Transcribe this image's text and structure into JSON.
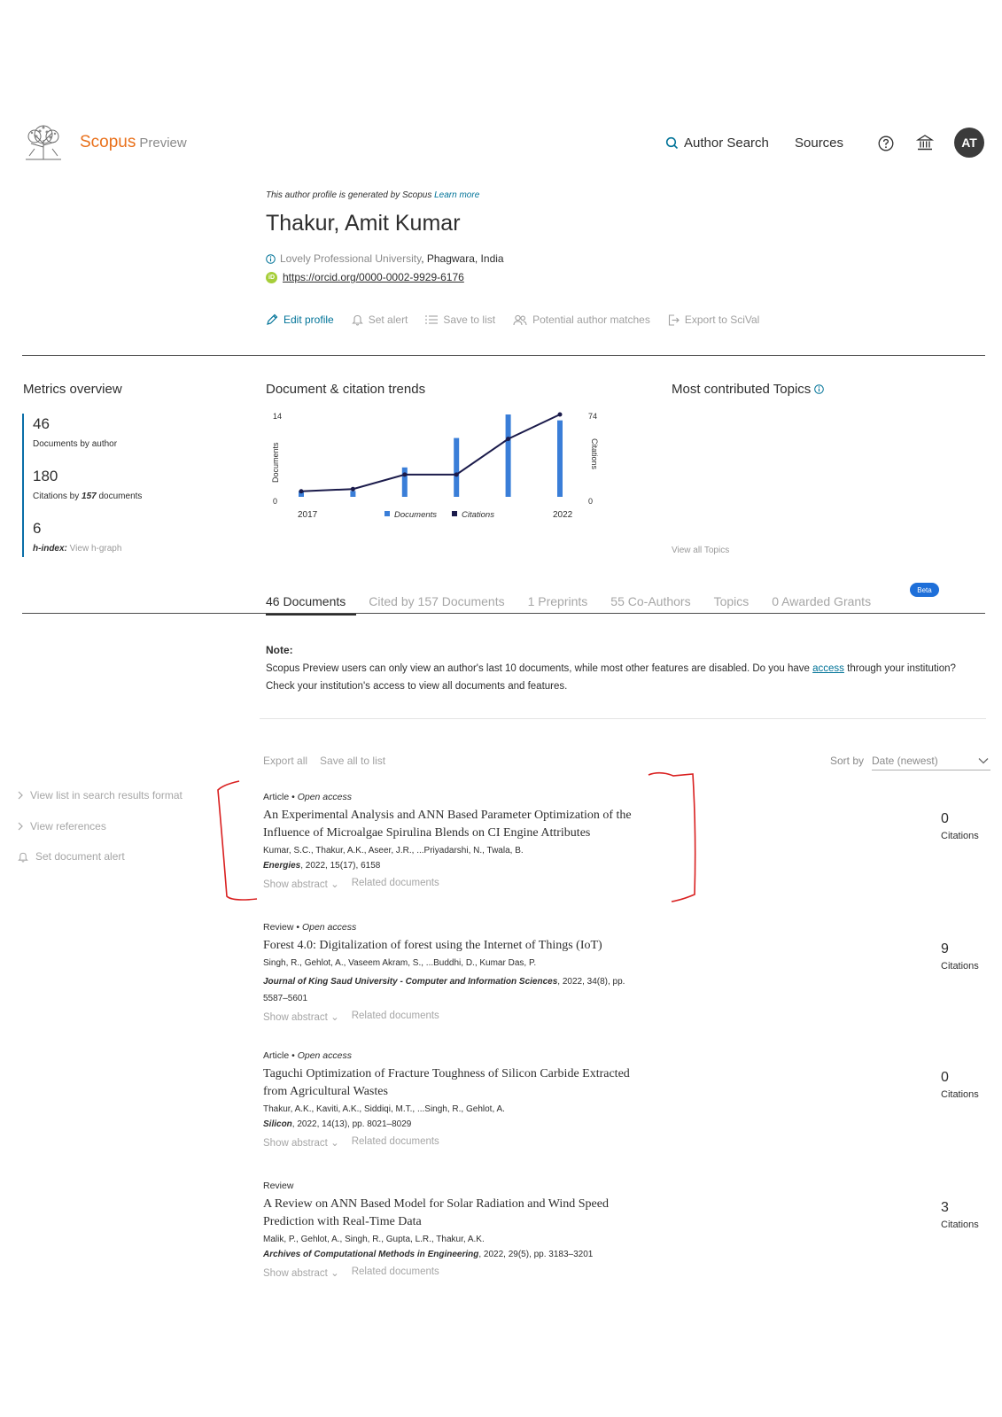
{
  "header": {
    "brand": "Scopus",
    "brand_suffix": "Preview",
    "nav_author_search": "Author Search",
    "nav_sources": "Sources",
    "avatar_initials": "AT",
    "icons": [
      "search-icon",
      "help-icon",
      "institution-icon"
    ]
  },
  "profile": {
    "generated_note": "This author profile is generated by Scopus",
    "learn_more": "Learn more",
    "name": "Thakur, Amit Kumar",
    "affiliation": "Lovely Professional University",
    "location": ", Phagwara, India",
    "orcid": "https://orcid.org/0000-0002-9929-6176",
    "orcid_badge": "iD",
    "actions": {
      "edit": "Edit profile",
      "alert": "Set alert",
      "save": "Save to list",
      "matches": "Potential author matches",
      "export": "Export to SciVal"
    }
  },
  "metrics": {
    "title": "Metrics overview",
    "documents_value": "46",
    "documents_label": "Documents by author",
    "citations_value": "180",
    "citations_label_pre": "Citations by ",
    "citations_label_num": "157",
    "citations_label_post": " documents",
    "hindex_value": "6",
    "hindex_label": "h-index:",
    "hindex_link": "View h-graph"
  },
  "trends": {
    "title": "Document & citation trends"
  },
  "topics": {
    "title": "Most contributed Topics",
    "view_all": "View all Topics"
  },
  "chart_data": {
    "type": "bar",
    "categories": [
      "2017",
      "2018",
      "2019",
      "2020",
      "2021",
      "2022"
    ],
    "xlabel_ticks": [
      "2017",
      "2022"
    ],
    "series": [
      {
        "name": "Documents",
        "values": [
          1,
          1,
          5,
          10,
          14,
          13
        ],
        "axis": "left",
        "color": "#3a7ed8"
      },
      {
        "name": "Citations",
        "values": [
          5,
          7,
          20,
          20,
          52,
          74
        ],
        "axis": "right",
        "type": "line",
        "color": "#1b1b4b"
      }
    ],
    "ylabel_left": "Documents",
    "ylabel_right": "Citations",
    "ylim_left": [
      0,
      14
    ],
    "ylim_right": [
      0,
      74
    ],
    "left_ticks": [
      "0",
      "14"
    ],
    "right_ticks": [
      "0",
      "74"
    ],
    "legend_position": "bottom",
    "grid": false
  },
  "tabs": [
    {
      "label": "46 Documents",
      "active": true
    },
    {
      "label": "Cited by 157 Documents",
      "active": false
    },
    {
      "label": "1 Preprints",
      "active": false
    },
    {
      "label": "55 Co-Authors",
      "active": false
    },
    {
      "label": "Topics",
      "active": false
    },
    {
      "label": "0 Awarded Grants",
      "active": false
    }
  ],
  "beta_badge": "Beta",
  "note": {
    "title": "Note:",
    "text_pre": "Scopus Preview users can only view an author's last 10 documents, while most other features are disabled. Do you have ",
    "access_link": "access",
    "text_post": " through your institution? Check your institution's access to view all documents and features."
  },
  "list_controls": {
    "export_all": "Export all",
    "save_all": "Save all to list",
    "sort_by": "Sort by",
    "sort_value": "Date (newest)"
  },
  "side_links": {
    "view_list": "View list in search results format",
    "view_refs": "View references",
    "set_alert": "Set document alert"
  },
  "documents": [
    {
      "type": "Article",
      "access": "Open access",
      "title": "An Experimental Analysis and ANN Based Parameter Optimization of the Influence of Microalgae Spirulina Blends on CI Engine Attributes",
      "authors": "Kumar, S.C., Thakur, A.K., Aseer, J.R., ...Priyadarshi, N., Twala, B.",
      "source": "Energies",
      "details": ", 2022, 15(17), 6158",
      "citations": "0",
      "citations_label": "Citations"
    },
    {
      "type": "Review",
      "access": "Open access",
      "title": "Forest 4.0: Digitalization of forest using the Internet of Things (IoT)",
      "authors": "Singh, R., Gehlot, A., Vaseem Akram, S., ...Buddhi, D., Kumar Das, P.",
      "source": "Journal of King Saud University - Computer and Information Sciences",
      "details": ", 2022, 34(8), pp. 5587–5601",
      "citations": "9",
      "citations_label": "Citations"
    },
    {
      "type": "Article",
      "access": "Open access",
      "title": "Taguchi Optimization of Fracture Toughness of Silicon Carbide Extracted from Agricultural Wastes",
      "authors": "Thakur, A.K., Kaviti, A.K., Siddiqi, M.T., ...Singh, R., Gehlot, A.",
      "source": "Silicon",
      "details": ", 2022, 14(13), pp. 8021–8029",
      "citations": "0",
      "citations_label": "Citations"
    },
    {
      "type": "Review",
      "access": "",
      "title": "A Review on ANN Based Model for Solar Radiation and Wind Speed Prediction with Real-Time Data",
      "authors": "Malik, P., Gehlot, A., Singh, R., Gupta, L.R., Thakur, A.K.",
      "source": "Archives of Computational Methods in Engineering",
      "details": ", 2022, 29(5), pp. 3183–3201",
      "citations": "3",
      "citations_label": "Citations"
    }
  ],
  "doc_links": {
    "show_abstract": "Show abstract",
    "related": "Related documents"
  }
}
